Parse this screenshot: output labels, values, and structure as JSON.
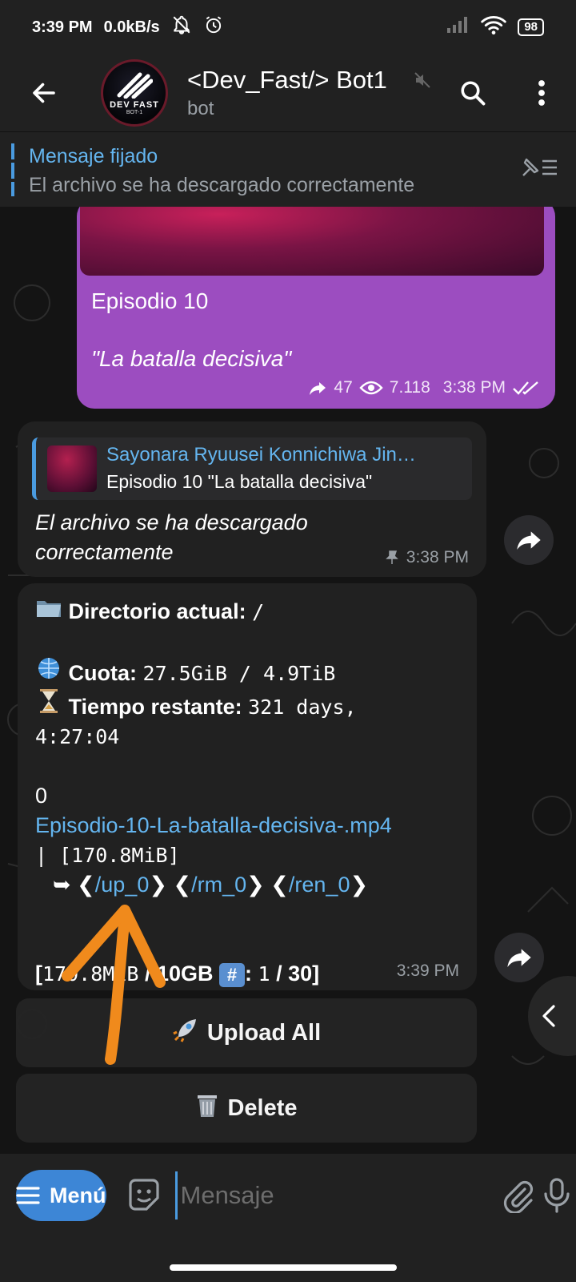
{
  "status_bar": {
    "time": "3:39 PM",
    "net_speed": "0.0kB/s",
    "battery": "98"
  },
  "header": {
    "title": "<Dev_Fast/> Bot1",
    "subtitle": "bot",
    "avatar_text": "DEV FAST",
    "avatar_sub": "BOT-1"
  },
  "pinned": {
    "title": "Mensaje fijado",
    "text": "El archivo se ha descargado correctamente"
  },
  "messages": {
    "outgoing": {
      "episode": "Episodio 10",
      "episode_subtitle": "\"La batalla decisiva\"",
      "shares": "47",
      "views": "7.118",
      "time": "3:38 PM"
    },
    "reply_msg": {
      "reply_name": "Sayonara Ryuusei Konnichiwa Jin…",
      "reply_text": "Episodio 10  \"La batalla decisiva\"",
      "text": "El archivo se ha descargado correctamente",
      "time": "3:38 PM"
    },
    "directory_msg": {
      "dir_label": "Directorio actual:",
      "dir_value": "/",
      "quota_label": "Cuota:",
      "quota_value": "27.5GiB / 4.9TiB",
      "time_label": "Tiempo restante:",
      "time_value": "321 days,",
      "time_value2": "4:27:04",
      "index": "0",
      "filename": "Episodio-10-La-batalla-decisiva-.mp4",
      "filesize": "| [170.8MiB]",
      "cmd_up": "/up_0",
      "cmd_rm": "/rm_0",
      "cmd_ren": "/ren_0",
      "total_used": "170.8MiB",
      "total_limit": "10GB",
      "count": "1",
      "count_total": "30",
      "time": "3:39 PM"
    }
  },
  "keyboard": {
    "upload_label": "Upload All",
    "delete_label": "Delete"
  },
  "input": {
    "menu_label": "Menú",
    "placeholder": "Mensaje"
  },
  "colors": {
    "accent": "#3d86d6",
    "link": "#64b5ef",
    "outgoing_bubble": "#9c4dc0",
    "annotation_arrow": "#f08a1c"
  }
}
